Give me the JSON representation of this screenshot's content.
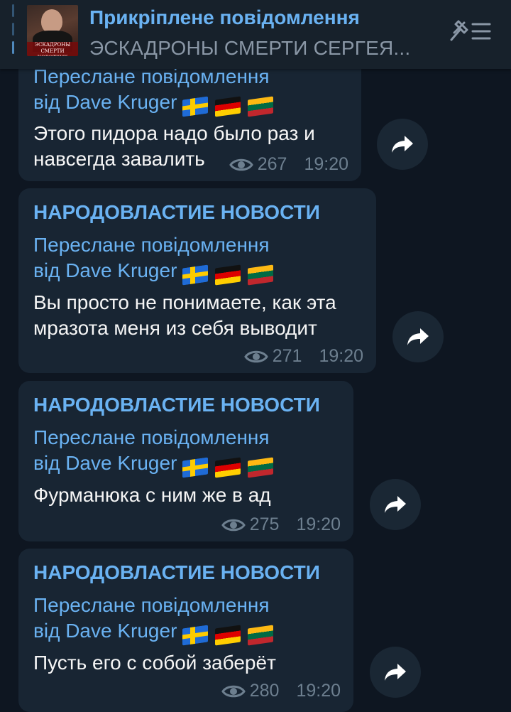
{
  "pinned": {
    "title": "Прикріплене повідомлення",
    "text": "ЭСКАДРОНЫ СМЕРТИ СЕРГЕЯ...",
    "thumbnail_caption": "ЭСКАДРОНЫ СМЕРТИ КОРОТКИХ"
  },
  "messages": [
    {
      "sender": "",
      "forward_line1": "Переслане повідомлення",
      "forward_line2": "від Dave Kruger",
      "flags": [
        "sweden-flag",
        "germany-flag",
        "lithuania-flag"
      ],
      "text_line1": "Этого пидора надо было раз и",
      "text_line2": "навсегда завалить",
      "views": "267",
      "time": "19:20"
    },
    {
      "sender": "НАРОДОВЛАСТИЕ НОВОСТИ",
      "forward_line1": "Переслане повідомлення",
      "forward_line2": "від Dave Kruger",
      "flags": [
        "sweden-flag",
        "germany-flag",
        "lithuania-flag"
      ],
      "text_line1": "Вы просто не понимаете, как эта",
      "text_line2": "мразота меня из себя выводит",
      "views": "271",
      "time": "19:20"
    },
    {
      "sender": "НАРОДОВЛАСТИЕ НОВОСТИ",
      "forward_line1": "Переслане повідомлення",
      "forward_line2": "від Dave Kruger",
      "flags": [
        "sweden-flag",
        "germany-flag",
        "lithuania-flag"
      ],
      "text_line1": "Фурманюка с ним же в ад",
      "text_line2": "",
      "views": "275",
      "time": "19:20"
    },
    {
      "sender": "НАРОДОВЛАСТИЕ НОВОСТИ",
      "forward_line1": "Переслане повідомлення",
      "forward_line2": "від Dave Kruger",
      "flags": [
        "sweden-flag",
        "germany-flag",
        "lithuania-flag"
      ],
      "text_line1": "Пусть его с собой заберёт",
      "text_line2": "",
      "views": "280",
      "time": "19:20"
    }
  ],
  "colors": {
    "background": "#0e1621",
    "bubble": "#182533",
    "accent": "#6ab2f2",
    "meta": "#6d7f8f"
  }
}
